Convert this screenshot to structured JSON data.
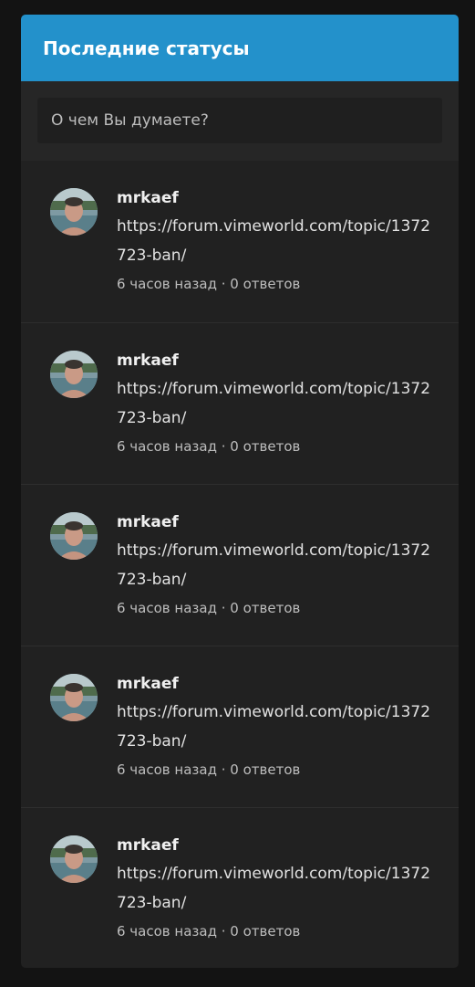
{
  "widget": {
    "title": "Последние статусы",
    "composer_placeholder": "О чем Вы думаете?"
  },
  "statuses": [
    {
      "author": "mrkaef",
      "text": "https://forum.vimeworld.com/topic/1372723-ban/",
      "time": "6 часов назад",
      "separator": "·",
      "replies": "0 ответов"
    },
    {
      "author": "mrkaef",
      "text": "https://forum.vimeworld.com/topic/1372723-ban/",
      "time": "6 часов назад",
      "separator": "·",
      "replies": "0 ответов"
    },
    {
      "author": "mrkaef",
      "text": "https://forum.vimeworld.com/topic/1372723-ban/",
      "time": "6 часов назад",
      "separator": "·",
      "replies": "0 ответов"
    },
    {
      "author": "mrkaef",
      "text": "https://forum.vimeworld.com/topic/1372723-ban/",
      "time": "6 часов назад",
      "separator": "·",
      "replies": "0 ответов"
    },
    {
      "author": "mrkaef",
      "text": "https://forum.vimeworld.com/topic/1372723-ban/",
      "time": "6 часов назад",
      "separator": "·",
      "replies": "0 ответов"
    }
  ],
  "colors": {
    "header_bg": "#2391cb",
    "widget_bg": "#212121",
    "page_bg": "#131313"
  },
  "icons": {
    "avatar": "user-avatar-photo"
  }
}
